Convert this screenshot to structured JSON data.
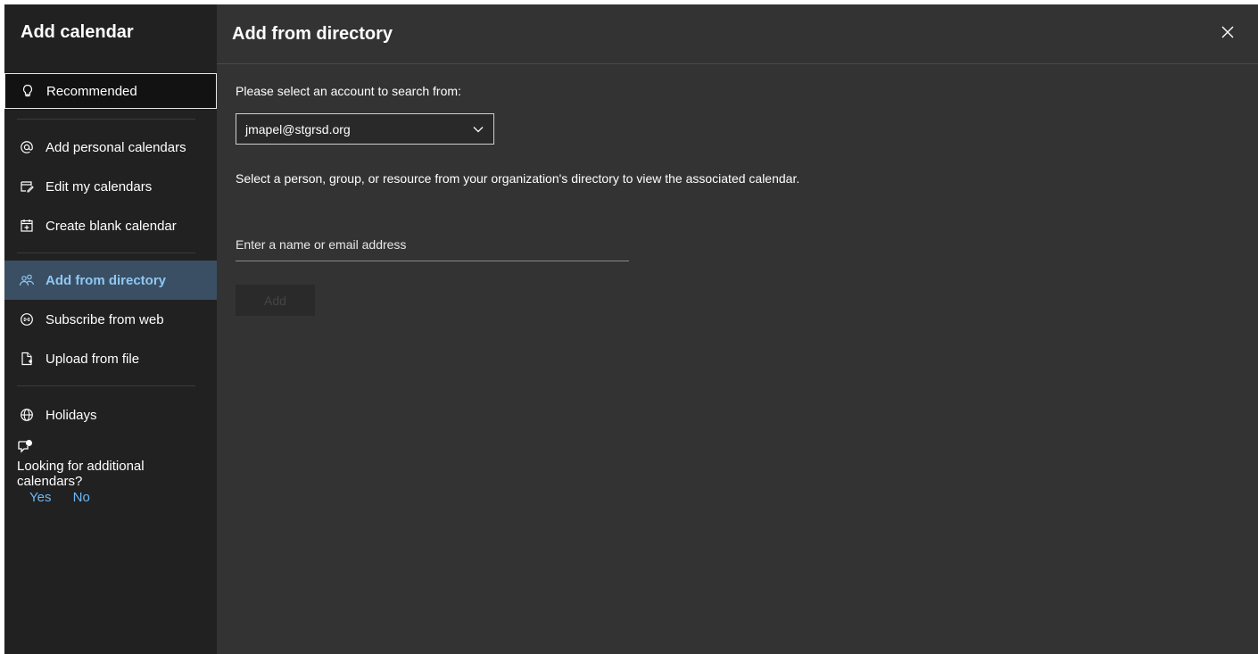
{
  "sidebar": {
    "title": "Add calendar",
    "items": {
      "recommended": "Recommended",
      "add_personal": "Add personal calendars",
      "edit_my": "Edit my calendars",
      "create_blank": "Create blank calendar",
      "add_directory": "Add from directory",
      "subscribe_web": "Subscribe from web",
      "upload_file": "Upload from file",
      "holidays": "Holidays"
    },
    "feedback": {
      "question": "Looking for additional calendars?",
      "yes": "Yes",
      "no": "No"
    }
  },
  "main": {
    "title": "Add from directory",
    "account_label": "Please select an account to search from:",
    "account_value": "jmapel@stgrsd.org",
    "description": "Select a person, group, or resource from your organization's directory to view the associated calendar.",
    "name_placeholder": "Enter a name or email address",
    "add_label": "Add"
  },
  "colors": {
    "accent": "#8fc8f4",
    "link": "#6cb8f6",
    "selected_bg": "#3a4f63"
  }
}
